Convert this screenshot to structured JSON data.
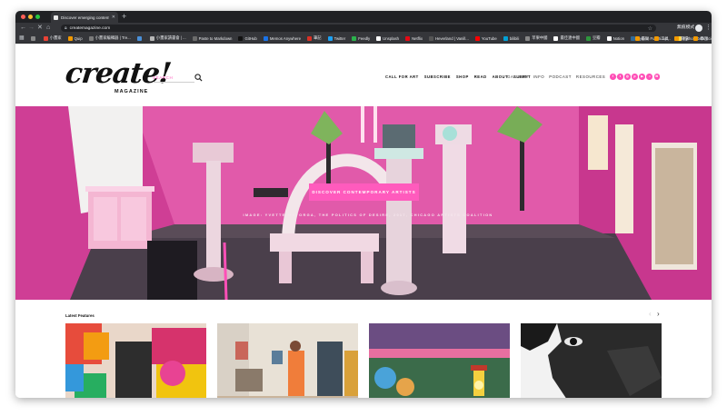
{
  "browser": {
    "tab_title": "Discover emerging contemporar",
    "url": "createmagazine.com",
    "profile_label": "無痕模式",
    "bookmarks": [
      {
        "label": "",
        "color": "#8a8a8a"
      },
      {
        "label": "小畫家",
        "color": "#e94235"
      },
      {
        "label": "Quip",
        "color": "#f29900"
      },
      {
        "label": "小畫家編輯器 | Tre...",
        "color": "#7b7b7b"
      },
      {
        "label": "",
        "color": "#4a90d9"
      },
      {
        "label": "小畫家讀書會 | ...",
        "color": "#b7b7b7"
      },
      {
        "label": "Paste to Markdown",
        "color": "#6b6b6b"
      },
      {
        "label": "GitHub",
        "color": "#111111"
      },
      {
        "label": "Memos Anywhere",
        "color": "#1a73e8"
      },
      {
        "label": "筆記",
        "color": "#d93025"
      },
      {
        "label": "Twitter",
        "color": "#1da1f2"
      },
      {
        "label": "Feedly",
        "color": "#2bb24c"
      },
      {
        "label": "Unsplash",
        "color": "#ffffff"
      },
      {
        "label": "Netflix",
        "color": "#e50914"
      },
      {
        "label": "Heverland | Vanill...",
        "color": "#555555"
      },
      {
        "label": "YouTube",
        "color": "#ff0000"
      },
      {
        "label": "bilibili",
        "color": "#00a1d6"
      },
      {
        "label": "苹果中國",
        "color": "#888888"
      },
      {
        "label": "最佳連中國",
        "color": "#ffffff"
      },
      {
        "label": "豆瓣",
        "color": "#2e963d"
      },
      {
        "label": "Notion",
        "color": "#ffffff"
      },
      {
        "label": "Python Functions...",
        "color": "#306998"
      },
      {
        "label": "Python Data Scien...",
        "color": "#ffd43b"
      }
    ],
    "bookmarks_right": [
      {
        "label": "書架",
        "color": "#f29900"
      },
      {
        "label": "工具",
        "color": "#f29900"
      },
      {
        "label": "閱讀",
        "color": "#f29900"
      },
      {
        "label": "學習",
        "color": "#f29900"
      }
    ]
  },
  "header": {
    "logo_text": "create!",
    "logo_subtext": "MAGAZINE",
    "search_placeholder": "SEARCH",
    "main_nav": [
      "CALL FOR ART",
      "SUBSCRIBE",
      "SHOP",
      "READ",
      "ABOUT",
      "SUBMIT"
    ],
    "secondary_nav": [
      "GALLERY",
      "INFO",
      "PODCAST",
      "RESOURCES",
      "BOOK"
    ],
    "social": [
      {
        "icon": "facebook-icon",
        "glyph": "f"
      },
      {
        "icon": "twitter-icon",
        "glyph": "t"
      },
      {
        "icon": "instagram-icon",
        "glyph": "◎"
      },
      {
        "icon": "pinterest-icon",
        "glyph": "p"
      },
      {
        "icon": "youtube-icon",
        "glyph": "▶"
      },
      {
        "icon": "spotify-icon",
        "glyph": "♫"
      },
      {
        "icon": "email-icon",
        "glyph": "✉"
      }
    ],
    "accent_color": "#ff5bbd"
  },
  "hero": {
    "cta_label": "DISCOVER CONTEMPORARY ARTISTS",
    "caption": "IMAGE: YVETTE MAYORGA, THE POLITICS OF DESIRE, 2017, CHICAGO ARTISTS COALITION"
  },
  "features": {
    "title": "Latest Features",
    "prev_glyph": "‹",
    "next_glyph": "›",
    "cards": [
      {
        "name": "feature-card-1"
      },
      {
        "name": "feature-card-2"
      },
      {
        "name": "feature-card-3"
      },
      {
        "name": "feature-card-4"
      }
    ]
  }
}
